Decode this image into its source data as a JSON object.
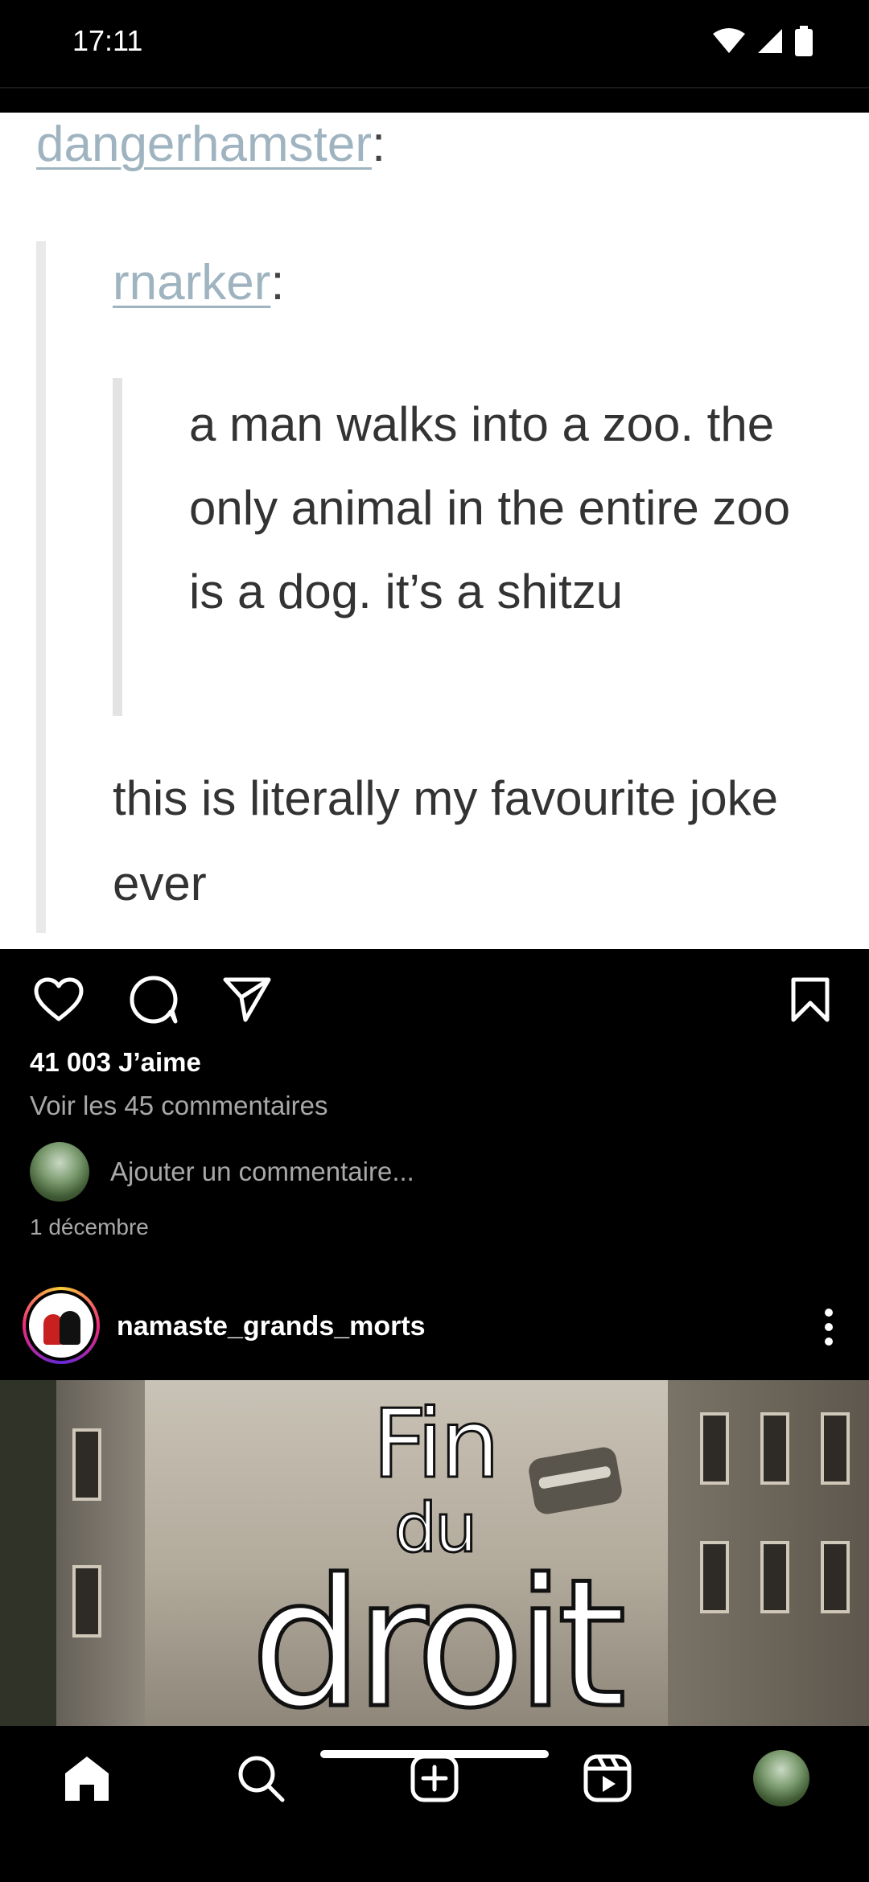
{
  "status_bar": {
    "time": "17:11"
  },
  "post": {
    "image": {
      "user1": "dangerhamster",
      "user2": "rnarker",
      "joke": "a man walks into a zoo. the only animal in the entire zoo is a dog. it’s a shitzu",
      "comment": "this is literally my favourite joke ever"
    },
    "likes": "41 003 J’aime",
    "view_comments": "Voir les 45 commentaires",
    "add_comment_placeholder": "Ajouter un commentaire...",
    "date": "1 décembre"
  },
  "next_post": {
    "username": "namaste_grands_morts",
    "image_text": {
      "line1": "Fin",
      "line2": "du",
      "line3": "droit"
    }
  },
  "icons": {
    "status": [
      "wifi-icon",
      "signal-icon",
      "battery-icon"
    ],
    "actions": [
      "heart-icon",
      "comment-icon",
      "share-icon",
      "bookmark-icon"
    ],
    "nav": [
      "home-icon",
      "search-icon",
      "create-icon",
      "reels-icon",
      "profile-avatar"
    ]
  },
  "colors": {
    "background": "#000000",
    "text": "#ffffff",
    "muted": "#a8a8a8",
    "tumblr_link": "#9fb4c0"
  }
}
